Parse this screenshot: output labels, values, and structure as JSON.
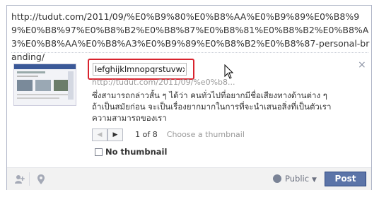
{
  "composer": {
    "url_text": "http://tudut.com/2011/09/%E0%B9%80%E0%B8%AA%E0%B9%89%E0%B8%99%E0%B8%97%E0%B8%B2%E0%B8%87%E0%B8%81%E0%B8%B2%E0%B8%A3%E0%B8%AA%E0%B8%A3%E0%B9%89%E0%B8%B2%E0%B8%87-personal-branding/"
  },
  "attachment": {
    "title_value": "lefghijklmnopqrstuvwxyz",
    "link_url": "http://tudut.com/2011/09/%e0%b8...",
    "description": "ซึ่งสามารถกล่าวสั้น ๆ ได้ว่า คนทั่วไปที่อยากมีชื่อเสียงทางด้านต่าง ๆ ถ้าเป็นสมัยก่อน จะเป็นเรื่องยากมากในการที่จะนำเสนอสิ่งที่เป็นตัวเรา ความสามารถของเรา",
    "thumb_nav": {
      "count": "1 of 8",
      "hint": "Choose a thumbnail",
      "prev_icon": "triangle-left-icon",
      "next_icon": "triangle-right-icon"
    },
    "no_thumbnail_label": "No thumbnail",
    "close_label": "×"
  },
  "footer": {
    "privacy_label": "Public",
    "post_label": "Post"
  },
  "colors": {
    "post_button": "#5b74a8",
    "highlight": "#d9232e"
  }
}
